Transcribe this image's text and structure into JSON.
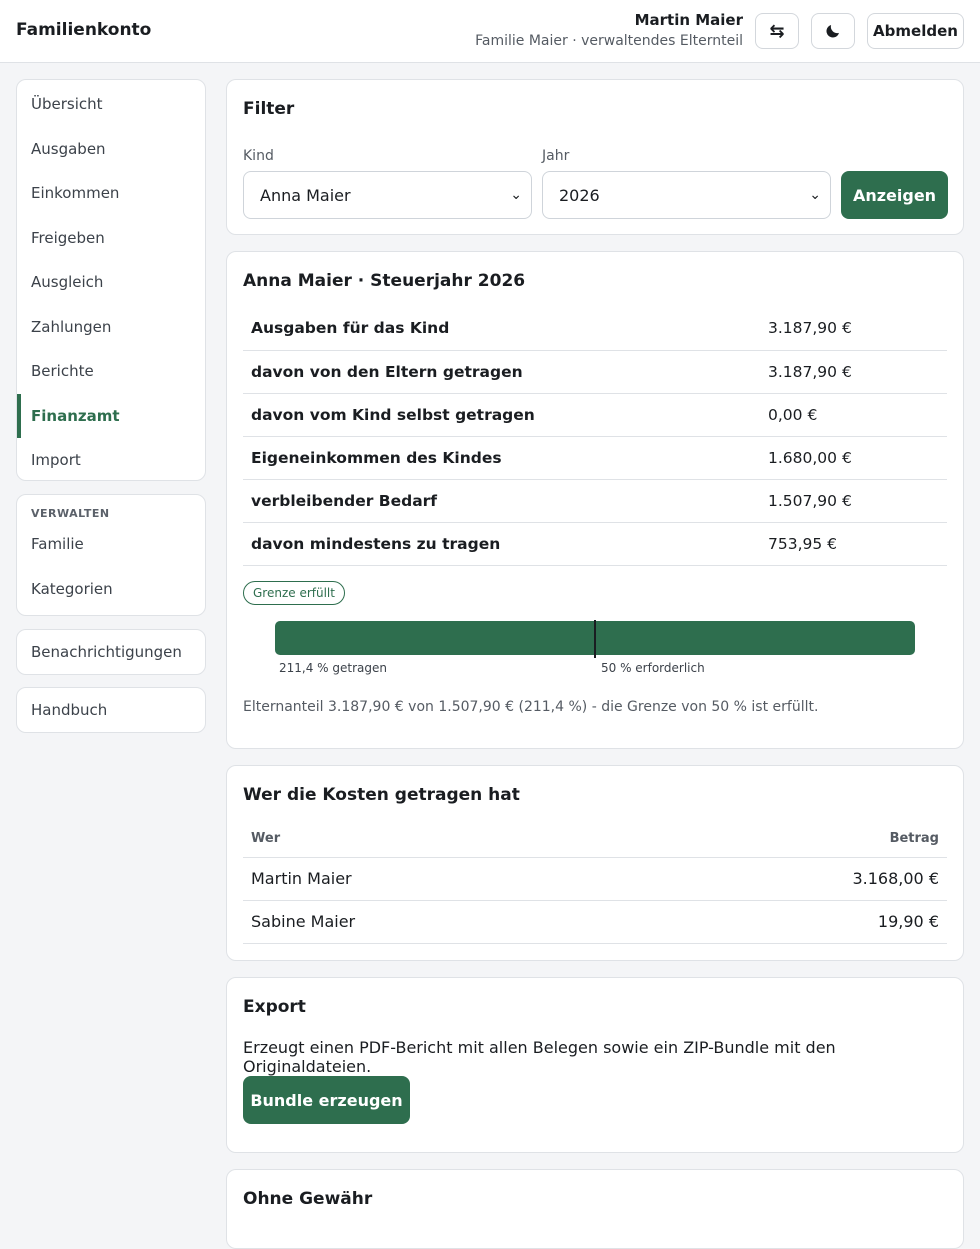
{
  "header": {
    "brand": "Familienkonto",
    "user_name": "Martin Maier",
    "user_sub": "Familie Maier · verwaltendes Elternteil",
    "switch_icon": "⇆",
    "theme_icon": "moon-icon",
    "logout_label": "Abmelden"
  },
  "sidebar": {
    "main_items": [
      {
        "label": "Übersicht"
      },
      {
        "label": "Ausgaben"
      },
      {
        "label": "Einkommen"
      },
      {
        "label": "Freigeben"
      },
      {
        "label": "Ausgleich"
      },
      {
        "label": "Zahlungen"
      },
      {
        "label": "Berichte"
      },
      {
        "label": "Finanzamt",
        "active": true
      },
      {
        "label": "Import"
      }
    ],
    "manage_title": "VERWALTEN",
    "manage_items": [
      {
        "label": "Familie"
      },
      {
        "label": "Kategorien"
      }
    ],
    "notifications": "Benachrichtigungen",
    "manual": "Handbuch"
  },
  "filter": {
    "title": "Filter",
    "child_label": "Kind",
    "child_value": "Anna Maier",
    "year_label": "Jahr",
    "year_value": "2026",
    "show_label": "Anzeigen"
  },
  "summary": {
    "title": "Anna Maier · Steuerjahr 2026",
    "rows": [
      {
        "label": "Ausgaben für das Kind",
        "value": "3.187,90 €"
      },
      {
        "label": "davon von den Eltern getragen",
        "value": "3.187,90 €"
      },
      {
        "label": "davon vom Kind selbst getragen",
        "value": "0,00 €"
      },
      {
        "label": "Eigeneinkommen des Kindes",
        "value": "1.680,00 €"
      },
      {
        "label": "verbleibender Bedarf",
        "value": "1.507,90 €"
      },
      {
        "label": "davon mindestens zu tragen",
        "value": "753,95 €"
      }
    ],
    "badge": "Grenze erfüllt",
    "progress": {
      "carried_fraction": 1.0,
      "required_fraction": 0.5,
      "carried_label": "211,4 % getragen",
      "required_label": "50 % erforderlich"
    },
    "note": "Elternanteil 3.187,90 € von 1.507,90 € (211,4 %) - die Grenze von 50 % ist erfüllt."
  },
  "payers": {
    "title": "Wer die Kosten getragen hat",
    "col_who": "Wer",
    "col_amount": "Betrag",
    "rows": [
      {
        "who": "Martin Maier",
        "amount": "3.168,00 €"
      },
      {
        "who": "Sabine Maier",
        "amount": "19,90 €"
      }
    ]
  },
  "export": {
    "title": "Export",
    "text": "Erzeugt einen PDF-Bericht mit allen Belegen sowie ein ZIP-Bundle mit den Originaldateien.",
    "button": "Bundle erzeugen"
  },
  "disclaimer": {
    "title": "Ohne Gewähr"
  },
  "colors": {
    "accent": "#2e6e4e",
    "background": "#f4f5f7"
  }
}
